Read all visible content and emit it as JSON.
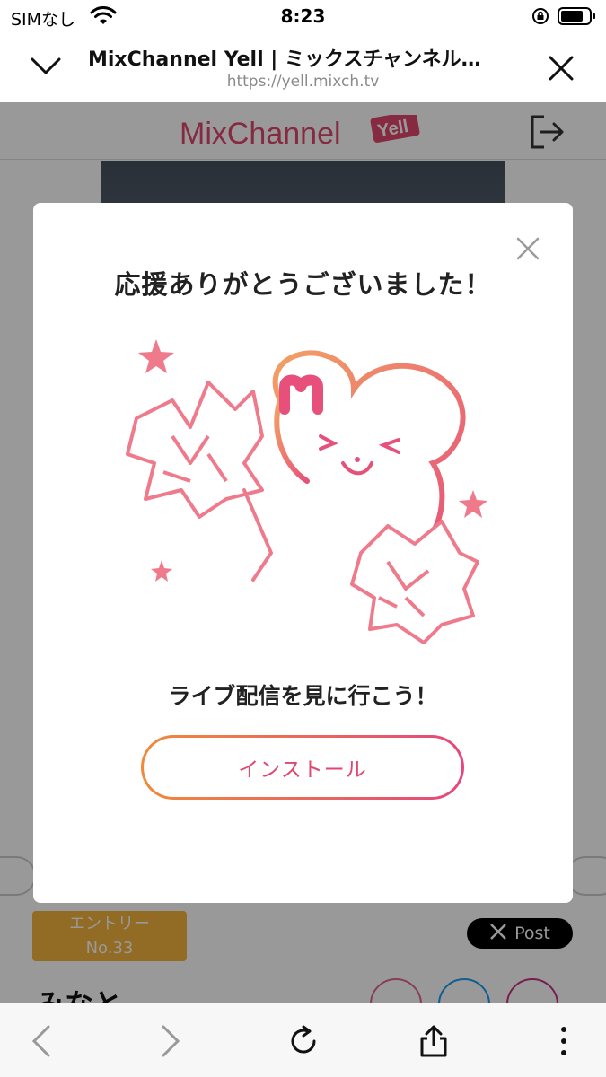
{
  "status_bar": {
    "carrier": "SIMなし",
    "time": "8:23",
    "icons": [
      "wifi-icon",
      "orientation-lock-icon",
      "battery-icon"
    ]
  },
  "browser": {
    "title": "MixChannel Yell | ミックスチャンネル…",
    "url": "https://yell.mixch.tv",
    "icons": [
      "chevron-down-icon",
      "close-icon"
    ]
  },
  "site": {
    "logo_text": "MixChannel",
    "logo_badge": "Yell",
    "entry_badge": {
      "line1": "エントリー",
      "line2": "No.33"
    },
    "x_post_label": "Post",
    "performer_name": "みなと",
    "colors": {
      "brand": "#e0476f",
      "badge": "#f3b23d"
    }
  },
  "modal": {
    "title": "応援ありがとうございました！",
    "subtitle": "ライブ配信を見に行こう！",
    "install_label": "インストール",
    "colors": {
      "gradient_start": "#f08a3a",
      "gradient_end": "#e5477c"
    }
  },
  "toolbar": {
    "icons": [
      "back-icon",
      "forward-icon",
      "reload-icon",
      "share-icon",
      "more-icon"
    ]
  }
}
